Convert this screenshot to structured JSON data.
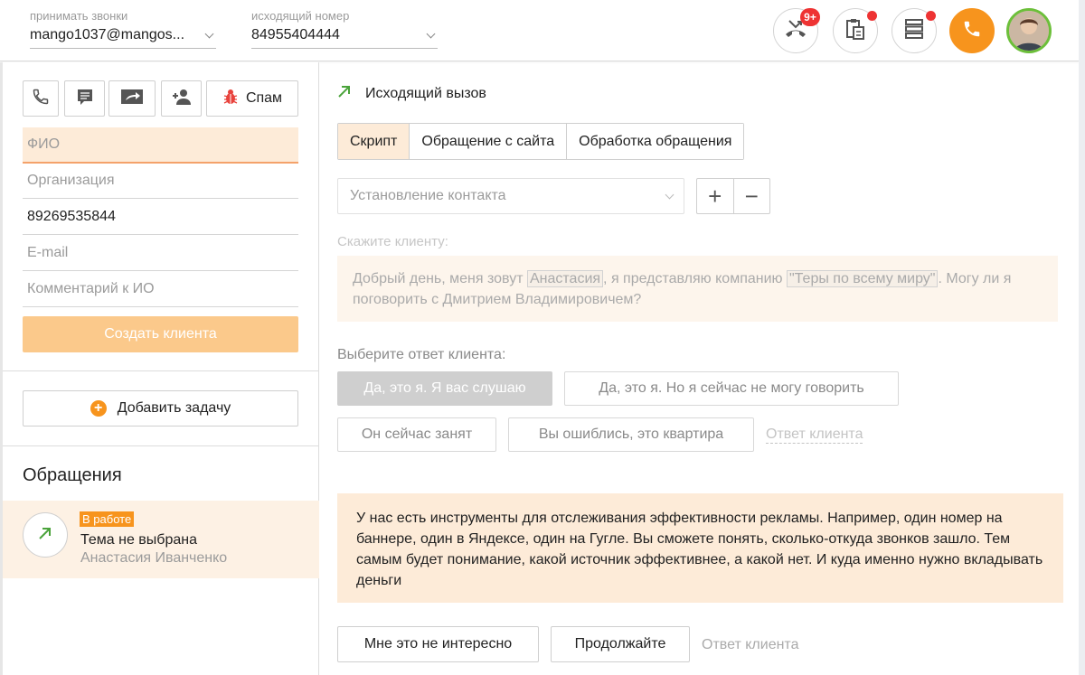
{
  "topbar": {
    "accept_calls_label": "принимать звонки",
    "accept_calls_value": "mango1037@mangos...",
    "outgoing_label": "исходящий номер",
    "outgoing_value": "84955404444",
    "missed_badge": "9+"
  },
  "contact": {
    "spam_label": "Спам",
    "fio_placeholder": "ФИО",
    "org_placeholder": "Организация",
    "phone_value": "89269535844",
    "email_placeholder": "E-mail",
    "comment_placeholder": "Комментарий к ИО",
    "create_label": "Создать клиента",
    "add_task_label": "Добавить задачу"
  },
  "appeals": {
    "title": "Обращения",
    "item": {
      "status": "В работе",
      "theme": "Тема не выбрана",
      "person": "Анастасия Иванченко"
    }
  },
  "call": {
    "title": "Исходящий вызов",
    "tabs": [
      "Скрипт",
      "Обращение с сайта",
      "Обработка обращения"
    ],
    "active_tab": 0,
    "stage": "Установление контакта",
    "say_label": "Скажите клиенту:",
    "script": {
      "part1": "Добрый день, меня зовут ",
      "name": "Анастасия",
      "part2": ", я представляю компанию ",
      "company": "\"Теры по всему миру\"",
      "part3": ". Могу ли я поговорить с Дмитрием Владимировичем?"
    },
    "choose_label": "Выберите ответ клиента:",
    "answers": [
      "Да, это я. Я вас слушаю",
      "Да, это я. Но я сейчас не могу говорить",
      "Он сейчас занят",
      "Вы ошиблись, это квартира"
    ],
    "answer_note": "Ответ клиента",
    "info_text": "У нас есть инструменты для отслеживания эффективности рекламы. Например, один номер на баннере, один в Яндексе, один на Гугле. Вы сможете понять, сколько-откуда звонков зашло. Тем самым будет понимание, какой источник эффективнее, а какой нет. И куда именно нужно вкладывать деньги",
    "answers2": [
      "Мне это не интересно",
      "Продолжайте"
    ],
    "answer_note2": "Ответ клиента"
  },
  "colors": {
    "accent": "#f7941d",
    "active_fill": "#fdebd8",
    "notification": "#e33333",
    "avatar_ring": "#6cbf3a"
  },
  "icons": [
    "phone-icon",
    "message-icon",
    "forward-icon",
    "add-contact-icon",
    "bug-icon",
    "missed-call-icon",
    "clipboard-icon",
    "server-icon",
    "call-icon",
    "outgoing-arrow-icon",
    "plus-circle-icon",
    "chevron-down-icon"
  ]
}
